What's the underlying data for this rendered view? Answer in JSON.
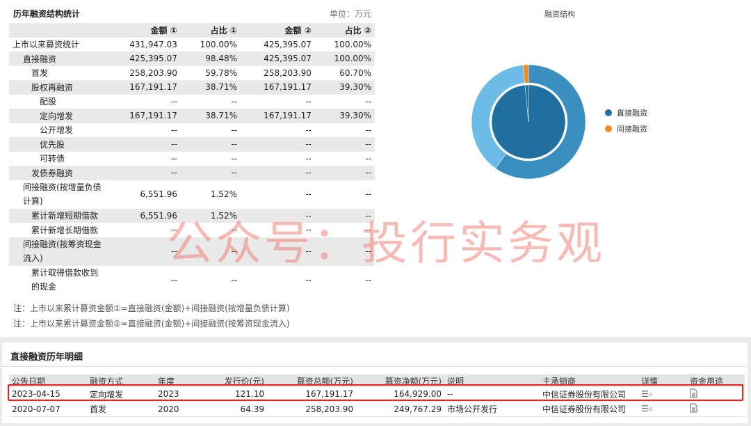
{
  "panel": {
    "title": "历年融资结构统计",
    "unit": "单位：万元"
  },
  "table": {
    "headers": [
      "",
      "金额 ①",
      "占比 ①",
      "金额 ②",
      "占比 ②"
    ],
    "rows": [
      {
        "label": "上市以来募资统计",
        "v": [
          "431,947.03",
          "100.00%",
          "425,395.07",
          "100.00%"
        ]
      },
      {
        "label": "直接融资",
        "v": [
          "425,395.07",
          "98.48%",
          "425,395.07",
          "100.00%"
        ]
      },
      {
        "label": "首发",
        "v": [
          "258,203.90",
          "59.78%",
          "258,203.90",
          "60.70%"
        ]
      },
      {
        "label": "股权再融资",
        "v": [
          "167,191.17",
          "38.71%",
          "167,191.17",
          "39.30%"
        ]
      },
      {
        "label": "配股",
        "v": [
          "--",
          "--",
          "--",
          "--"
        ]
      },
      {
        "label": "定向增发",
        "v": [
          "167,191.17",
          "38.71%",
          "167,191.17",
          "39.30%"
        ]
      },
      {
        "label": "公开增发",
        "v": [
          "--",
          "--",
          "--",
          "--"
        ]
      },
      {
        "label": "优先股",
        "v": [
          "--",
          "--",
          "--",
          "--"
        ]
      },
      {
        "label": "可转债",
        "v": [
          "--",
          "--",
          "--",
          "--"
        ]
      },
      {
        "label": "发债券融资",
        "v": [
          "--",
          "--",
          "--",
          "--"
        ]
      },
      {
        "label": "间接融资(按增量负债计算)",
        "v": [
          "6,551.96",
          "1.52%",
          "--",
          "--"
        ]
      },
      {
        "label": "累计新增短期借款",
        "v": [
          "6,551.96",
          "1.52%",
          "--",
          "--"
        ]
      },
      {
        "label": "累计新增长期借款",
        "v": [
          "--",
          "--",
          "--",
          "--"
        ]
      },
      {
        "label": "间接融资(按筹资现金流入)",
        "v": [
          "--",
          "--",
          "--",
          "--"
        ]
      },
      {
        "label": "累计取得借款收到的现金",
        "v": [
          "--",
          "--",
          "--",
          "--"
        ]
      }
    ]
  },
  "notes": [
    "注：上市以来累计募资金额①=直接融资(金额)+间接融资(按增量负债计算)",
    "注：上市以来累计募资金额②=直接融资(金额)+间接融资(按筹资现金流入)"
  ],
  "chart_data": {
    "type": "pie",
    "title": "融资结构",
    "inner": [
      {
        "name": "直接融资",
        "value": 98.48,
        "color": "#1f6f9f"
      },
      {
        "name": "间接融资",
        "value": 1.52,
        "color": "#1f6f9f"
      }
    ],
    "outer": [
      {
        "value": 59.78,
        "color": "#3a8fc0"
      },
      {
        "value": 38.71,
        "color": "#6bbde8"
      },
      {
        "value": 1.52,
        "color": "#f08a1c"
      }
    ],
    "legend": [
      {
        "name": "直接融资",
        "color": "#1f6f9f"
      },
      {
        "name": "间接融资",
        "color": "#f08a1c"
      }
    ]
  },
  "detail": {
    "title": "直接融资历年明细",
    "headers": [
      "公告日期",
      "融资方式",
      "年度",
      "发行价(元)",
      "募资总额(万元)",
      "募资净额(万元)",
      "说明",
      "主承销商",
      "详情",
      "资金用途"
    ],
    "rows": [
      [
        "2023-04-15",
        "定向增发",
        "2023",
        "121.10",
        "167,191.17",
        "164,929.00",
        "--",
        "中信证券股份有限公司"
      ],
      [
        "2020-07-07",
        "首发",
        "2020",
        "64.39",
        "258,203.90",
        "249,767.29",
        "市场公开发行",
        "中信证券股份有限公司"
      ]
    ]
  },
  "watermark": "公众号：投行实务观"
}
